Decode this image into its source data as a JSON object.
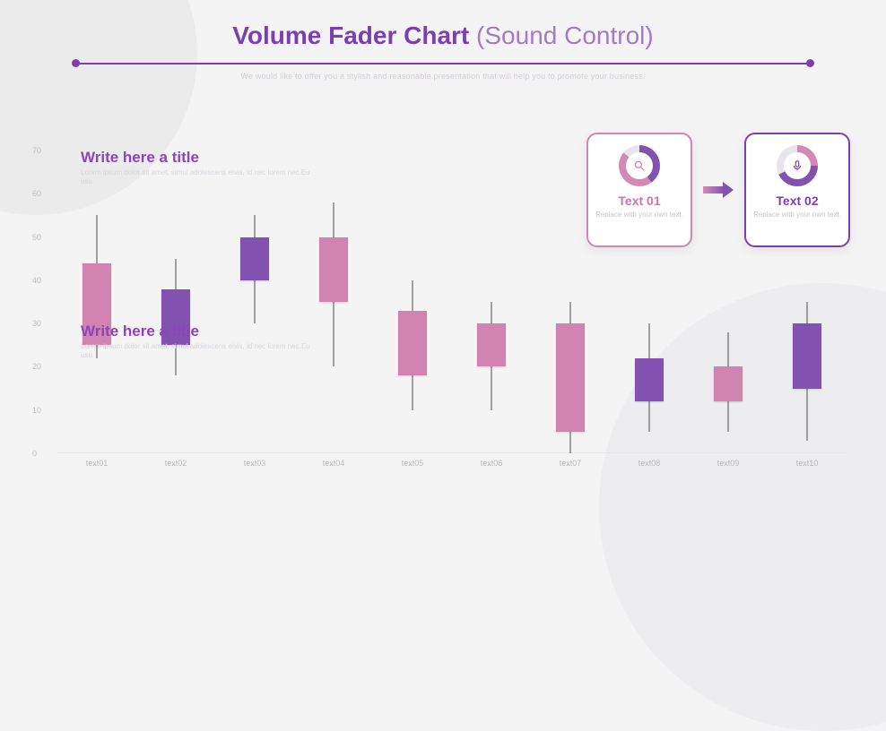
{
  "title_main": "Volume Fader Chart",
  "title_sub": " (Sound Control)",
  "tagline": "We would like to offer you a stylish and reasonable presentation that will help you to promote your business.",
  "note_top": {
    "title": "Write here a title",
    "body": "Lorem ipsum dolor sit amet, simul adolescens eivis, id nec lorem nec.Eu usu."
  },
  "note_bot": {
    "title": "Write here a title",
    "body": "Lorem ipsum dolor sit amet, simul adolescens eivis, id nec lorem nec.Eu usu."
  },
  "cards": {
    "left": {
      "title": "Text 01",
      "body": "Replace with your own text."
    },
    "right": {
      "title": "Text 02",
      "body": "Replace with your own text."
    }
  },
  "chart_data": {
    "type": "bar",
    "title": "Volume Fader Chart",
    "xlabel": "",
    "ylabel": "",
    "ylim": [
      0,
      70
    ],
    "y_ticks": [
      0,
      10,
      20,
      30,
      40,
      50,
      60,
      70
    ],
    "categories": [
      "text01",
      "text02",
      "text03",
      "text04",
      "text05",
      "text06",
      "text07",
      "text08",
      "text09",
      "text10"
    ],
    "series": [
      {
        "name": "whisker_low",
        "values": [
          22,
          18,
          30,
          20,
          10,
          10,
          0,
          5,
          5,
          3
        ]
      },
      {
        "name": "box_low",
        "values": [
          25,
          25,
          40,
          35,
          18,
          20,
          5,
          12,
          12,
          15
        ]
      },
      {
        "name": "box_high",
        "values": [
          44,
          38,
          50,
          50,
          33,
          30,
          30,
          22,
          20,
          30
        ]
      },
      {
        "name": "whisker_high",
        "values": [
          55,
          45,
          55,
          58,
          40,
          35,
          35,
          30,
          28,
          35
        ]
      }
    ],
    "colors": [
      "pink",
      "purple",
      "purple",
      "pink",
      "pink",
      "pink",
      "pink",
      "purple",
      "pink",
      "purple"
    ]
  }
}
